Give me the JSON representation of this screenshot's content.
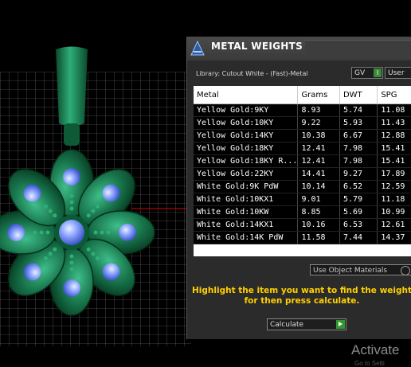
{
  "panel": {
    "title": "METAL WEIGHTS",
    "library_label": "Library: Cutout White - (Fast)-Metal",
    "gv_label": "GV",
    "user_label": "User",
    "columns": [
      "Metal",
      "Grams",
      "DWT",
      "SPG"
    ],
    "rows": [
      [
        "Yellow Gold:9KY",
        "8.93",
        "5.74",
        "11.08"
      ],
      [
        "Yellow Gold:10KY",
        "9.22",
        "5.93",
        "11.43"
      ],
      [
        "Yellow Gold:14KY",
        "10.38",
        "6.67",
        "12.88"
      ],
      [
        "Yellow Gold:18KY",
        "12.41",
        "7.98",
        "15.41"
      ],
      [
        "Yellow Gold:18KY R...",
        "12.41",
        "7.98",
        "15.41"
      ],
      [
        "Yellow Gold:22KY",
        "14.41",
        "9.27",
        "17.89"
      ],
      [
        "White Gold:9K PdW",
        "10.14",
        "6.52",
        "12.59"
      ],
      [
        "White Gold:10KX1",
        "9.01",
        "5.79",
        "11.18"
      ],
      [
        "White Gold:10KW",
        "8.85",
        "5.69",
        "10.99"
      ],
      [
        "White Gold:14KX1",
        "10.16",
        "6.53",
        "12.61"
      ],
      [
        "White Gold:14K PdW",
        "11.58",
        "7.44",
        "14.37"
      ]
    ],
    "use_object_materials_label": "Use Object Materials",
    "instruction": "Highlight the item you want to find the weight for then press calculate.",
    "calculate_label": "Calculate"
  },
  "watermark": {
    "title": "Activate",
    "subtitle": "Go to Setti"
  },
  "colors": {
    "accent_yellow": "#ffd000",
    "model_green": "#1e8a5a",
    "gem_blue": "#8fa8ff"
  }
}
